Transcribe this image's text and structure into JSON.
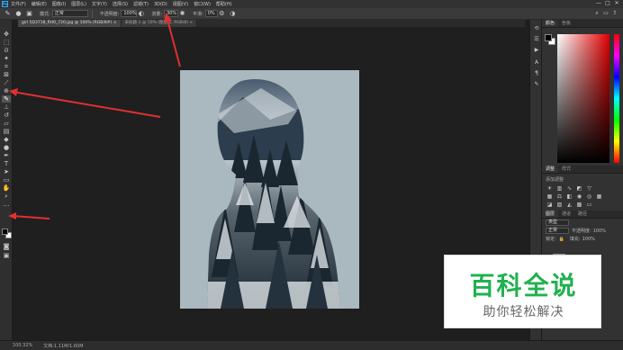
{
  "menubar": {
    "logo": "Ps",
    "items": [
      "文件(F)",
      "编辑(E)",
      "图像(I)",
      "图层(L)",
      "文字(Y)",
      "选择(S)",
      "滤镜(T)",
      "3D(D)",
      "视图(V)",
      "窗口(W)",
      "帮助(H)"
    ],
    "window_buttons": [
      "—",
      "□",
      "✕"
    ]
  },
  "options": {
    "mode_label": "模式:",
    "mode_value": "正常",
    "opacity_label": "不透明度:",
    "opacity_value": "100%",
    "flow_label": "流量:",
    "flow_value": "30%",
    "smooth_label": "平滑:",
    "smooth_value": "0%"
  },
  "tabs": [
    {
      "label": "girl 5D3718_RH0_720.jpg @ 100% (RGB/8#) ×"
    },
    {
      "label": "未标题-1 @ 50% (图层 1, RGB/8) ×"
    }
  ],
  "status": {
    "zoom": "100.32%",
    "doc": "文档:1.11M/1.60M"
  },
  "color_panel": {
    "tabs": [
      "颜色",
      "色板"
    ]
  },
  "adjust_panel": {
    "tabs": [
      "调整",
      "样式"
    ],
    "hint": "添加调整"
  },
  "layers_panel": {
    "tabs": [
      "图层",
      "通道",
      "路径"
    ],
    "kind_label": "类型",
    "blend": "正常",
    "opacity_label": "不透明度:",
    "opacity_value": "100%",
    "lock_label": "锁定:",
    "fill_label": "填充:",
    "fill_value": "100%"
  },
  "watermark": {
    "title": "百科全说",
    "subtitle": "助你轻松解决"
  },
  "colors": {
    "accent": "#31a8ff",
    "arrow": "#e03030",
    "watermark_green": "#21b14f",
    "canvas_bg": "#aab9bf"
  }
}
